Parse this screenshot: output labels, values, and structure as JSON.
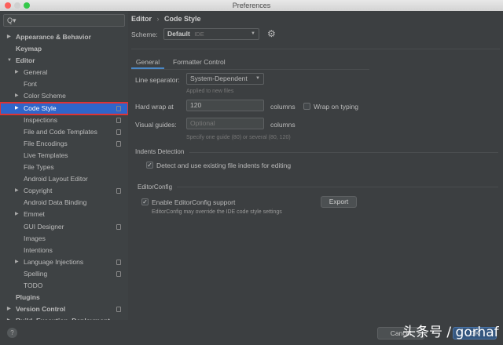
{
  "window": {
    "title": "Preferences"
  },
  "search": {
    "placeholder": "Q▾"
  },
  "sidebar": {
    "items": [
      {
        "label": "Appearance & Behavior",
        "level": 0,
        "bold": true,
        "arrow": "▶"
      },
      {
        "label": "Keymap",
        "level": 0,
        "bold": true,
        "arrow": ""
      },
      {
        "label": "Editor",
        "level": 0,
        "bold": true,
        "arrow": "▼"
      },
      {
        "label": "General",
        "level": 1,
        "arrow": "▶"
      },
      {
        "label": "Font",
        "level": 1,
        "arrow": ""
      },
      {
        "label": "Color Scheme",
        "level": 1,
        "arrow": "▶"
      },
      {
        "label": "Code Style",
        "level": 1,
        "arrow": "▶",
        "selected": true,
        "icon": true
      },
      {
        "label": "Inspections",
        "level": 1,
        "arrow": "",
        "icon": true
      },
      {
        "label": "File and Code Templates",
        "level": 1,
        "arrow": "",
        "icon": true
      },
      {
        "label": "File Encodings",
        "level": 1,
        "arrow": "",
        "icon": true
      },
      {
        "label": "Live Templates",
        "level": 1,
        "arrow": ""
      },
      {
        "label": "File Types",
        "level": 1,
        "arrow": ""
      },
      {
        "label": "Android Layout Editor",
        "level": 1,
        "arrow": ""
      },
      {
        "label": "Copyright",
        "level": 1,
        "arrow": "▶",
        "icon": true
      },
      {
        "label": "Android Data Binding",
        "level": 1,
        "arrow": ""
      },
      {
        "label": "Emmet",
        "level": 1,
        "arrow": "▶"
      },
      {
        "label": "GUI Designer",
        "level": 1,
        "arrow": "",
        "icon": true
      },
      {
        "label": "Images",
        "level": 1,
        "arrow": ""
      },
      {
        "label": "Intentions",
        "level": 1,
        "arrow": ""
      },
      {
        "label": "Language Injections",
        "level": 1,
        "arrow": "▶",
        "icon": true
      },
      {
        "label": "Spelling",
        "level": 1,
        "arrow": "",
        "icon": true
      },
      {
        "label": "TODO",
        "level": 1,
        "arrow": ""
      },
      {
        "label": "Plugins",
        "level": 0,
        "bold": true,
        "arrow": ""
      },
      {
        "label": "Version Control",
        "level": 0,
        "bold": true,
        "arrow": "▶",
        "icon": true
      },
      {
        "label": "Build, Execution, Deployment",
        "level": 0,
        "bold": true,
        "arrow": "▶"
      }
    ]
  },
  "breadcrumb": {
    "parent": "Editor",
    "sep": "›",
    "current": "Code Style"
  },
  "scheme": {
    "label": "Scheme:",
    "value": "Default",
    "tag": "IDE"
  },
  "tabs": [
    {
      "label": "General",
      "active": true
    },
    {
      "label": "Formatter Control"
    }
  ],
  "form": {
    "line_sep_label": "Line separator:",
    "line_sep_value": "System-Dependent",
    "line_sep_hint": "Applied to new files",
    "hard_wrap_label": "Hard wrap at",
    "hard_wrap_value": "120",
    "columns": "columns",
    "wrap_typing": "Wrap on typing",
    "visual_label": "Visual guides:",
    "visual_placeholder": "Optional",
    "visual_hint": "Specify one guide (80) or several (80, 120)",
    "indents_title": "Indents Detection",
    "indents_cb": "Detect and use existing file indents for editing",
    "ec_title": "EditorConfig",
    "ec_cb": "Enable EditorConfig support",
    "ec_hint": "EditorConfig may override the IDE code style settings",
    "export": "Export"
  },
  "footer": {
    "help": "?",
    "cancel": "Cancel",
    "ok": "OK"
  },
  "watermark": "头条号 / gorhaf"
}
